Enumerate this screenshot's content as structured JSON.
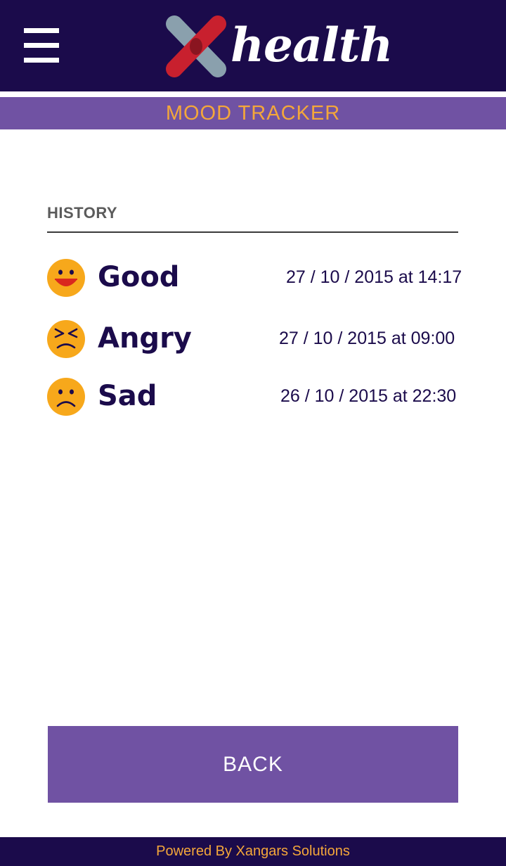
{
  "header": {
    "logo_text": "health",
    "menu_icon": "hamburger-menu-icon",
    "logo_icon": "xhealth-cross-logo-icon"
  },
  "page": {
    "title": "MOOD TRACKER"
  },
  "history": {
    "label": "HISTORY",
    "entries": [
      {
        "mood": "Good",
        "icon": "happy-face-icon",
        "date": "27 / 10 / 2015 at 14:17"
      },
      {
        "mood": "Angry",
        "icon": "angry-face-icon",
        "date": "27 / 10 / 2015 at 09:00"
      },
      {
        "mood": "Sad",
        "icon": "sad-face-icon",
        "date": "26 / 10 / 2015 at 22:30"
      }
    ]
  },
  "actions": {
    "back_label": "BACK"
  },
  "footer": {
    "text": "Powered By Xangars Solutions"
  },
  "colors": {
    "header_bg": "#1b0b4b",
    "accent_purple": "#7052a3",
    "accent_orange": "#f4a73a",
    "emoji_yellow": "#f7a81b"
  }
}
